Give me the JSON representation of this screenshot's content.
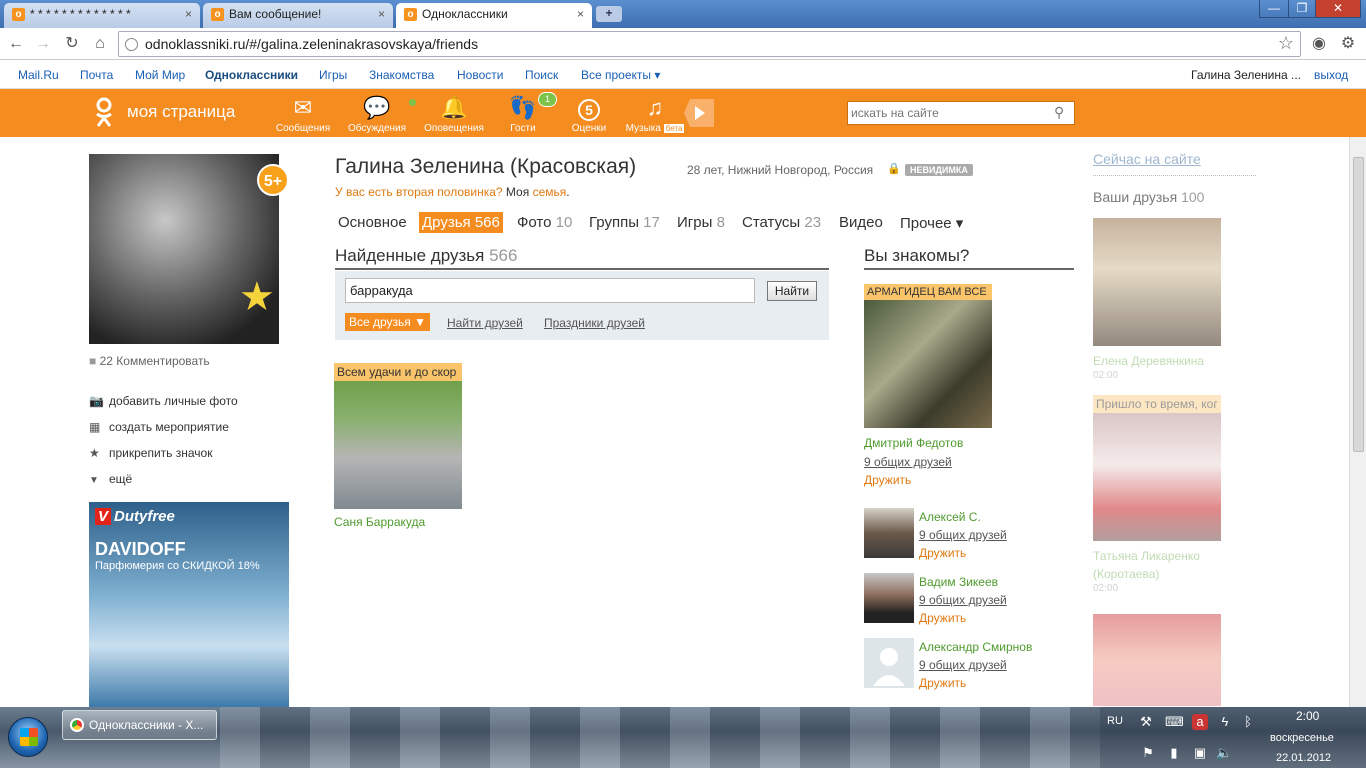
{
  "browser": {
    "tabs": [
      {
        "label": "* * * * * * * * * * * * *"
      },
      {
        "label": "Вам сообщение!"
      },
      {
        "label": "Одноклассники"
      }
    ],
    "close_glyph": "×",
    "new_tab_glyph": "+",
    "url": "odnoklassniki.ru/#/galina.zeleninakrasovskaya/friends",
    "window_buttons": {
      "minimize": "—",
      "maximize": "❐",
      "close": "✕"
    }
  },
  "mailbar": {
    "links": [
      "Mail.Ru",
      "Почта",
      "Мой Мир",
      "Одноклассники",
      "Игры",
      "Знакомства",
      "Новости",
      "Поиск",
      "Все проекты ▾"
    ],
    "user": "Галина Зеленина ...",
    "logout": "выход"
  },
  "okbar": {
    "brand": "моя страница",
    "items": [
      {
        "label": "Сообщения",
        "icon": "envelope-icon",
        "glyph": "✉"
      },
      {
        "label": "Обсуждения",
        "icon": "chat-bubbles-icon",
        "glyph": "💬"
      },
      {
        "label": "Оповещения",
        "icon": "bell-icon",
        "glyph": "🔔"
      },
      {
        "label": "Гости",
        "icon": "footprints-icon",
        "glyph": "👣"
      },
      {
        "label": "Оценки",
        "icon": "rating-five-icon",
        "glyph": "5"
      },
      {
        "label": "Музыка",
        "icon": "music-note-icon",
        "glyph": "♫"
      }
    ],
    "guests_badge": "1",
    "beta": "бета",
    "search_placeholder": "искать на сайте",
    "search_glyph": "⚲"
  },
  "profile": {
    "name": "Галина Зеленина (Красовская)",
    "meta": "28 лет, Нижний Новгород, Россия",
    "invisible": "НЕВИДИМКА",
    "partner_question": "У вас есть вторая половинка?",
    "family_prefix": "Моя",
    "family_link": "семья",
    "avatar_badge": "5+",
    "comments": "22 Комментировать",
    "actions": [
      {
        "label": "добавить личные фото",
        "glyph": "📷"
      },
      {
        "label": "создать мероприятие",
        "glyph": "▦"
      },
      {
        "label": "прикрепить значок",
        "glyph": "★"
      },
      {
        "label": "ещё",
        "glyph": "▼"
      }
    ]
  },
  "tabs": [
    {
      "label": "Основное",
      "count": ""
    },
    {
      "label": "Друзья",
      "count": "566"
    },
    {
      "label": "Фото",
      "count": "10"
    },
    {
      "label": "Группы",
      "count": "17"
    },
    {
      "label": "Игры",
      "count": "8"
    },
    {
      "label": "Статусы",
      "count": "23"
    },
    {
      "label": "Видео",
      "count": ""
    },
    {
      "label": "Прочее ▾",
      "count": ""
    }
  ],
  "found": {
    "title": "Найденные друзья",
    "count": "566",
    "query": "барракуда",
    "find_button": "Найти",
    "filter": "Все друзья ▼",
    "links": [
      "Найти друзей",
      "Праздники друзей"
    ],
    "results": [
      {
        "status": "Всем удачи и до скор",
        "name": "Саня Барракуда"
      }
    ]
  },
  "know": {
    "title": "Вы знакомы?",
    "featured": {
      "status": "АРМАГИДЕЦ ВАМ ВСЕ",
      "name": "Дмитрий Федотов",
      "common": "9 общих друзей",
      "add": "Дружить"
    },
    "people": [
      {
        "name": "Алексей С.",
        "common": "9 общих друзей",
        "add": "Дружить"
      },
      {
        "name": "Вадим Зикеев",
        "common": "9 общих друзей",
        "add": "Дружить"
      },
      {
        "name": "Александр Смирнов",
        "common": "9 общих друзей",
        "add": "Дружить"
      }
    ]
  },
  "online": {
    "title": "Сейчас на сайте",
    "friends_label": "Ваши друзья",
    "friends_count": "100",
    "people": [
      {
        "status": "",
        "name": "Елена Деревянкина",
        "time": "02:00"
      },
      {
        "status": "Пришло то время, ког",
        "name": "Татьяна Ликаренко (Коротаева)",
        "time": "02:00"
      },
      {
        "status": "",
        "name": "",
        "time": ""
      }
    ]
  },
  "ad": {
    "brand": "Dutyfree",
    "logo": "V",
    "title": "DAVIDOFF",
    "text": "Парфюмерия со СКИДКОЙ 18%"
  },
  "taskbar": {
    "app": "Одноклассники - Х...",
    "lang": "RU",
    "time": "2:00",
    "day": "воскресенье",
    "date": "22.01.2012"
  }
}
